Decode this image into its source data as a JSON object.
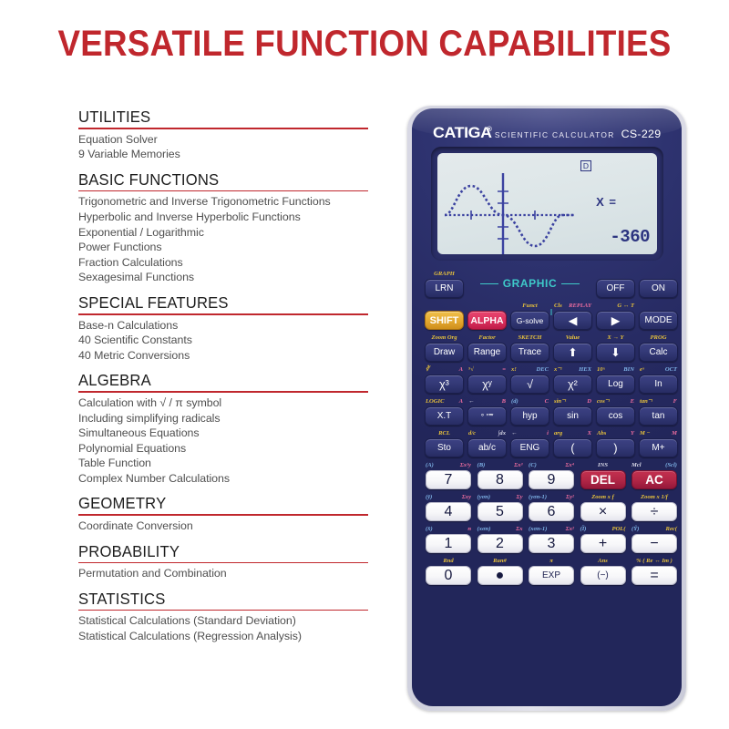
{
  "title": "VERSATILE FUNCTION CAPABILITIES",
  "accent_color": "#c0272d",
  "sections": [
    {
      "heading": "UTILITIES",
      "items": [
        "Equation Solver",
        "9 Variable Memories"
      ]
    },
    {
      "heading": "BASIC FUNCTIONS",
      "items": [
        "Trigonometric and Inverse Trigonometric Functions",
        "Hyperbolic and Inverse Hyperbolic Functions",
        "Exponential / Logarithmic",
        "Power Functions",
        "Fraction Calculations",
        "Sexagesimal Functions"
      ]
    },
    {
      "heading": "SPECIAL FEATURES",
      "items": [
        "Base-n Calculations",
        "40 Scientific Constants",
        "40 Metric Conversions"
      ]
    },
    {
      "heading": "ALGEBRA",
      "items": [
        "Calculation with √ / π symbol",
        "Including simplifying radicals",
        "Simultaneous Equations",
        "Polynomial Equations",
        "Table Function",
        "Complex Number Calculations"
      ]
    },
    {
      "heading": "GEOMETRY",
      "items": [
        "Coordinate Conversion"
      ]
    },
    {
      "heading": "PROBABILITY",
      "items": [
        "Permutation and Combination"
      ]
    },
    {
      "heading": "STATISTICS",
      "items": [
        "Statistical Calculations (Standard Deviation)",
        "Statistical Calculations (Regression Analysis)"
      ]
    }
  ],
  "calculator": {
    "brand": "CATIGA",
    "registered_mark": "®",
    "subtitle": "SCIENTIFIC  CALCULATOR",
    "model": "CS-229",
    "body_color": "#2b3068",
    "display": {
      "mode_indicator": "D",
      "prompt": "X =",
      "value": "-360",
      "graph": "sine wave"
    },
    "graphic_band_label": "GRAPHIC",
    "rows": [
      {
        "id": "row-power",
        "keys": [
          {
            "label": "LRN",
            "style": "dark",
            "size": "small",
            "above_center": "GRAPH",
            "above_color": "ly"
          },
          {
            "label": "OFF",
            "style": "dark",
            "size": "small"
          },
          {
            "label": "ON",
            "style": "dark",
            "size": "small"
          }
        ]
      },
      {
        "id": "row-shift",
        "keys": [
          {
            "label": "SHIFT",
            "style": "yellow"
          },
          {
            "label": "ALPHA",
            "style": "pink"
          },
          {
            "label": "G-solve",
            "style": "dark",
            "size": "tiny",
            "above_center": "Funct",
            "above_color": "ly"
          },
          {
            "label": "◀",
            "style": "dark",
            "above_left": "Cls",
            "above_left_color": "ly",
            "above_right": "REPLAY",
            "above_right_color": "lp"
          },
          {
            "label": "▶",
            "style": "dark",
            "above_right": "G ↔ T",
            "above_right_color": "ly"
          },
          {
            "label": "MODE",
            "style": "dark",
            "size": "small"
          }
        ]
      },
      {
        "id": "row-draw",
        "keys": [
          {
            "label": "Draw",
            "style": "dark",
            "size": "small",
            "above_center": "Zoom Org",
            "above_color": "ly"
          },
          {
            "label": "Range",
            "style": "dark",
            "size": "small",
            "above_center": "Factor",
            "above_color": "ly"
          },
          {
            "label": "Trace",
            "style": "dark",
            "size": "small",
            "above_center": "SKETCH",
            "above_color": "ly"
          },
          {
            "label": "⬆",
            "style": "dark",
            "above_center": "Value",
            "above_color": "ly"
          },
          {
            "label": "⬇",
            "style": "dark",
            "above_center": "X → Y",
            "above_color": "ly"
          },
          {
            "label": "Calc",
            "style": "dark",
            "size": "small",
            "above_center": "PROG",
            "above_color": "ly"
          }
        ]
      },
      {
        "id": "row-power-fn",
        "keys": [
          {
            "label": "χ³",
            "style": "dark",
            "above_left": "∛",
            "above_left_color": "ly",
            "above_right": "A",
            "above_right_color": "lp"
          },
          {
            "label": "χʸ",
            "style": "dark",
            "above_left": "⁵√",
            "above_left_color": "ly",
            "above_right": "=",
            "above_right_color": "lp"
          },
          {
            "label": "√",
            "style": "dark",
            "above_left": "x!",
            "above_left_color": "ly",
            "above_right": "DEC",
            "above_right_color": "lb"
          },
          {
            "label": "χ²",
            "style": "dark",
            "above_left": "x⁻¹",
            "above_left_color": "ly",
            "above_right": "HEX",
            "above_right_color": "lb"
          },
          {
            "label": "Log",
            "style": "dark",
            "size": "small",
            "above_left": "10ˣ",
            "above_left_color": "ly",
            "above_right": "BIN",
            "above_right_color": "lb"
          },
          {
            "label": "In",
            "style": "dark",
            "size": "small",
            "above_left": "eˣ",
            "above_left_color": "ly",
            "above_right": "OCT",
            "above_right_color": "lb"
          }
        ]
      },
      {
        "id": "row-trig",
        "keys": [
          {
            "label": "X.T",
            "style": "dark",
            "size": "small",
            "above_left": "LOGIC",
            "above_left_color": "ly",
            "above_right": "A",
            "above_right_color": "lp"
          },
          {
            "label": "° ′″‴",
            "style": "dark",
            "size": "tiny",
            "above_left": "←",
            "above_left_color": "lw",
            "above_right": "B",
            "above_right_color": "lp"
          },
          {
            "label": "hyp",
            "style": "dark",
            "size": "small",
            "above_left": "(d)",
            "above_left_color": "lb",
            "above_right": "C",
            "above_right_color": "lp"
          },
          {
            "label": "sin",
            "style": "dark",
            "size": "small",
            "above_left": "sin⁻¹",
            "above_left_color": "ly",
            "above_right": "D",
            "above_right_color": "lp"
          },
          {
            "label": "cos",
            "style": "dark",
            "size": "small",
            "above_left": "cos⁻¹",
            "above_left_color": "ly",
            "above_right": "E",
            "above_right_color": "lp"
          },
          {
            "label": "tan",
            "style": "dark",
            "size": "small",
            "above_left": "tan⁻¹",
            "above_left_color": "ly",
            "above_right": "F",
            "above_right_color": "lp"
          }
        ]
      },
      {
        "id": "row-sto",
        "keys": [
          {
            "label": "Sto",
            "style": "dark",
            "size": "small",
            "above_center": "RCL",
            "above_color": "ly"
          },
          {
            "label": "ab/c",
            "style": "dark",
            "size": "small",
            "above_left": "d/c",
            "above_left_color": "ly",
            "above_right": "∫dx",
            "above_right_color": "lw"
          },
          {
            "label": "ENG",
            "style": "dark",
            "size": "small",
            "above_left": "←",
            "above_left_color": "lw",
            "above_right": "i",
            "above_right_color": "lp"
          },
          {
            "label": "(",
            "style": "dark",
            "above_left": "arg",
            "above_left_color": "ly",
            "above_right": "X",
            "above_right_color": "lp"
          },
          {
            "label": ")",
            "style": "dark",
            "above_left": "Abs",
            "above_left_color": "ly",
            "above_right": "Y",
            "above_right_color": "lp"
          },
          {
            "label": "M+",
            "style": "dark",
            "size": "small",
            "above_left": "M −",
            "above_left_color": "ly",
            "above_right": "M",
            "above_right_color": "lp"
          }
        ]
      },
      {
        "id": "row-789",
        "keys": [
          {
            "label": "7",
            "style": "white",
            "size": "num",
            "above_left": "(A)",
            "above_left_color": "lb",
            "above_right": "Σx²y",
            "above_right_color": "lp"
          },
          {
            "label": "8",
            "style": "white",
            "size": "num",
            "above_left": "(B)",
            "above_left_color": "lb",
            "above_right": "Σx³",
            "above_right_color": "lp"
          },
          {
            "label": "9",
            "style": "white",
            "size": "num",
            "above_left": "(C)",
            "above_left_color": "lb",
            "above_right": "Σx⁴",
            "above_right_color": "lp"
          },
          {
            "label": "DEL",
            "style": "red",
            "above_center": "INS",
            "above_color": "lw"
          },
          {
            "label": "AC",
            "style": "red",
            "above_left": "Mcl",
            "above_left_color": "lw",
            "above_right": "(Scl)",
            "above_right_color": "lb"
          }
        ]
      },
      {
        "id": "row-456",
        "keys": [
          {
            "label": "4",
            "style": "white",
            "size": "num",
            "above_left": "(ȳ)",
            "above_left_color": "lb",
            "above_right": "Σxy",
            "above_right_color": "lp"
          },
          {
            "label": "5",
            "style": "white",
            "size": "num",
            "above_left": "(yσn)",
            "above_left_color": "lb",
            "above_right": "Σy",
            "above_right_color": "lp"
          },
          {
            "label": "6",
            "style": "white",
            "size": "num",
            "above_left": "(yσn-1)",
            "above_left_color": "lb",
            "above_right": "Σy²",
            "above_right_color": "lp"
          },
          {
            "label": "×",
            "style": "white",
            "size": "op",
            "above_center": "Zoom x f",
            "above_color": "ly"
          },
          {
            "label": "÷",
            "style": "white",
            "size": "op",
            "above_center": "Zoom x 1/f",
            "above_color": "ly"
          }
        ]
      },
      {
        "id": "row-123",
        "keys": [
          {
            "label": "1",
            "style": "white",
            "size": "num",
            "above_left": "(x̄)",
            "above_left_color": "lb",
            "above_right": "n",
            "above_right_color": "lp"
          },
          {
            "label": "2",
            "style": "white",
            "size": "num",
            "above_left": "(xσn)",
            "above_left_color": "lb",
            "above_right": "Σx",
            "above_right_color": "lp"
          },
          {
            "label": "3",
            "style": "white",
            "size": "num",
            "above_left": "(xσn-1)",
            "above_left_color": "lb",
            "above_right": "Σx²",
            "above_right_color": "lp"
          },
          {
            "label": "+",
            "style": "white",
            "size": "op",
            "above_left": "(Ȉ)",
            "above_left_color": "lb",
            "above_right": "POL(",
            "above_right_color": "ly"
          },
          {
            "label": "−",
            "style": "white",
            "size": "op",
            "above_left": "(Ŷ)",
            "above_left_color": "lb",
            "above_right": "Rec(",
            "above_right_color": "ly"
          }
        ]
      },
      {
        "id": "row-0",
        "keys": [
          {
            "label": "0",
            "style": "white",
            "size": "num",
            "above_center": "Rnd",
            "above_color": "ly"
          },
          {
            "label": "●",
            "style": "white",
            "size": "op",
            "above_center": "Ran#",
            "above_color": "ly"
          },
          {
            "label": "EXP",
            "style": "white",
            "size": "small",
            "above_center": "π",
            "above_color": "ly"
          },
          {
            "label": "(−)",
            "style": "white",
            "size": "small",
            "above_center": "Ans",
            "above_color": "ly"
          },
          {
            "label": "=",
            "style": "white",
            "size": "op",
            "above_center": "% ( Re ↔ Im )",
            "above_color": "ly"
          }
        ]
      }
    ]
  }
}
